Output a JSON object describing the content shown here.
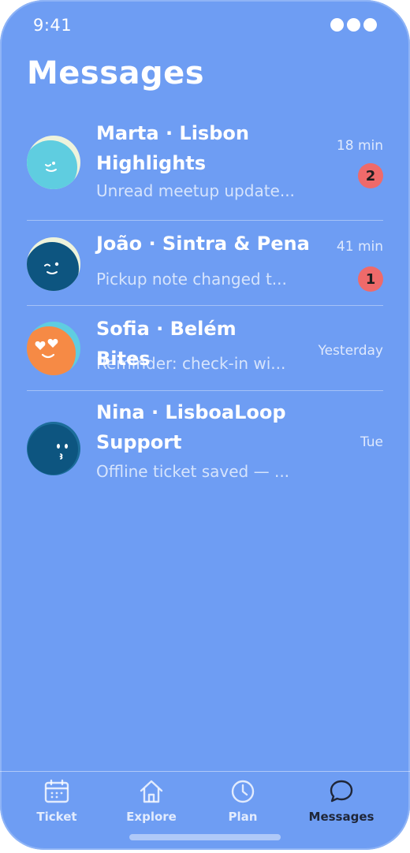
{
  "status_bar": {
    "time": "9:41"
  },
  "header": {
    "title": "Messages"
  },
  "conversations": [
    {
      "name": "Marta · Lisbon Highlights",
      "preview": "Unread meetup update...",
      "time": "18 min",
      "unread": "2",
      "avatar_icon": "wink-face-icon",
      "avatar_color": "#5fcde0"
    },
    {
      "name": "João · Sintra & Pena",
      "preview": "Pickup note changed t...",
      "time": "41 min",
      "unread": "1",
      "avatar_icon": "wink-face-icon",
      "avatar_color": "#0d5580"
    },
    {
      "name": "Sofia · Belém Bites",
      "preview": "Reminder: check-in wi...",
      "time": "Yesterday",
      "unread": "",
      "avatar_icon": "heart-eyes-face-icon",
      "avatar_color": "#f68a45"
    },
    {
      "name": "Nina · LisboaLoop Support",
      "preview": "Offline ticket saved — ...",
      "time": "Tue",
      "unread": "",
      "avatar_icon": "kiss-face-icon",
      "avatar_color": "#0d5580"
    }
  ],
  "tabbar": {
    "tabs": [
      {
        "label": "Ticket",
        "icon": "calendar-icon",
        "active": false
      },
      {
        "label": "Explore",
        "icon": "home-icon",
        "active": false
      },
      {
        "label": "Plan",
        "icon": "clock-icon",
        "active": false
      },
      {
        "label": "Messages",
        "icon": "chat-bubble-icon",
        "active": true
      }
    ]
  },
  "colors": {
    "background": "#6e9df3",
    "badge": "#ef6a6a",
    "active_tab": "#1f2638"
  }
}
